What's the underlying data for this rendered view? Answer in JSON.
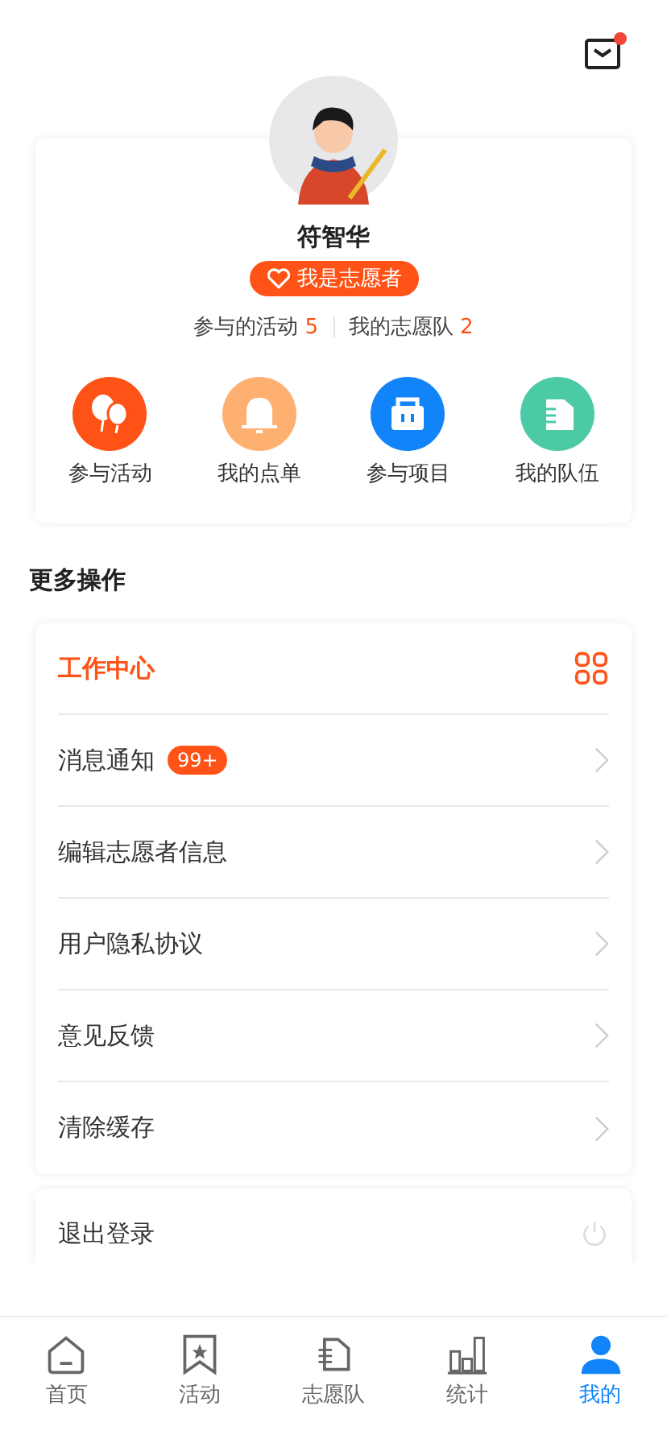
{
  "profile": {
    "name": "符智华",
    "badge": "我是志愿者",
    "stats": [
      {
        "label": "参与的活动",
        "value": "5"
      },
      {
        "label": "我的志愿队",
        "value": "2"
      }
    ],
    "has_unread_mail": true
  },
  "shortcuts": [
    {
      "label": "参与活动",
      "kind": "balloons",
      "color": "#fe5216"
    },
    {
      "label": "我的点单",
      "kind": "bell",
      "color": "#feb071"
    },
    {
      "label": "参与项目",
      "kind": "bag",
      "color": "#1184fa"
    },
    {
      "label": "我的队伍",
      "kind": "hand",
      "color": "#4ccaa6"
    }
  ],
  "section_title": "更多操作",
  "menu": [
    {
      "label": "工作中心",
      "kind": "header"
    },
    {
      "label": "消息通知",
      "kind": "link",
      "badge": "99+"
    },
    {
      "label": "编辑志愿者信息",
      "kind": "link"
    },
    {
      "label": "用户隐私协议",
      "kind": "link"
    },
    {
      "label": "意见反馈",
      "kind": "link"
    },
    {
      "label": "清除缓存",
      "kind": "link"
    }
  ],
  "logout": {
    "label": "退出登录"
  },
  "tabs": [
    {
      "label": "首页",
      "kind": "home",
      "selected": false
    },
    {
      "label": "活动",
      "kind": "bookmark",
      "selected": false
    },
    {
      "label": "志愿队",
      "kind": "hand",
      "selected": false
    },
    {
      "label": "统计",
      "kind": "chart",
      "selected": false
    },
    {
      "label": "我的",
      "kind": "user",
      "selected": true
    }
  ]
}
